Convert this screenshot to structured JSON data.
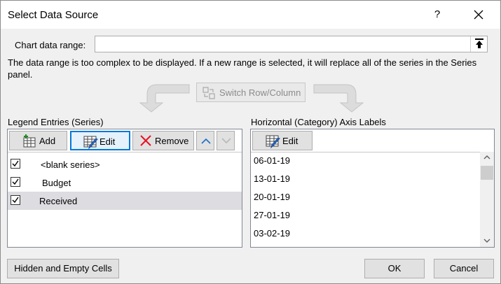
{
  "dialog": {
    "title": "Select Data Source",
    "help_label": "?"
  },
  "range": {
    "label": "Chart data range:",
    "value": ""
  },
  "note": "The data range is too complex to be displayed. If a new range is selected, it will replace all of the series in the Series panel.",
  "switch_label": "Switch Row/Column",
  "legend": {
    "title": "Legend Entries (Series)",
    "add_label": "Add",
    "edit_label": "Edit",
    "remove_label": "Remove",
    "series": [
      {
        "name": "<blank series>",
        "checked": true
      },
      {
        "name": "Budget",
        "checked": true
      },
      {
        "name": "Received",
        "checked": true,
        "selected": true
      }
    ]
  },
  "axis": {
    "title": "Horizontal (Category) Axis Labels",
    "edit_label": "Edit",
    "labels": [
      "06-01-19",
      "13-01-19",
      "20-01-19",
      "27-01-19",
      "03-02-19"
    ]
  },
  "footer": {
    "hidden_cells_label": "Hidden and Empty Cells",
    "ok_label": "OK",
    "cancel_label": "Cancel"
  },
  "colors": {
    "accent": "#0078d7",
    "remove_icon": "#e81123",
    "arrow_up": "#1a6ec7",
    "selection": "#dcdce1"
  },
  "icons": {
    "close": "close-icon",
    "collapse": "collapse-dialog-icon",
    "switch": "switch-row-column-icon",
    "add": "add-series-icon",
    "edit": "edit-table-icon",
    "remove": "remove-x-icon",
    "move_up": "chevron-up-icon",
    "move_down": "chevron-down-icon"
  }
}
